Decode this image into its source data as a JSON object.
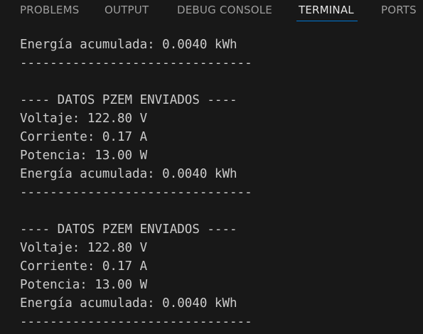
{
  "tabs": [
    {
      "label": "PROBLEMS",
      "active": false
    },
    {
      "label": "OUTPUT",
      "active": false
    },
    {
      "label": "DEBUG CONSOLE",
      "active": false
    },
    {
      "label": "TERMINAL",
      "active": true
    },
    {
      "label": "PORTS",
      "active": false
    }
  ],
  "colors": {
    "background": "#181818",
    "text": "#cccccc",
    "tab_inactive": "#9d9d9d",
    "tab_active": "#e7e7e7",
    "accent": "#0078d4"
  },
  "terminal": {
    "lines": [
      "Energía acumulada: 0.0040 kWh",
      "-------------------------------",
      "",
      "---- DATOS PZEM ENVIADOS ----",
      "Voltaje: 122.80 V",
      "Corriente: 0.17 A",
      "Potencia: 13.00 W",
      "Energía acumulada: 0.0040 kWh",
      "-------------------------------",
      "",
      "---- DATOS PZEM ENVIADOS ----",
      "Voltaje: 122.80 V",
      "Corriente: 0.17 A",
      "Potencia: 13.00 W",
      "Energía acumulada: 0.0040 kWh",
      "-------------------------------"
    ]
  }
}
